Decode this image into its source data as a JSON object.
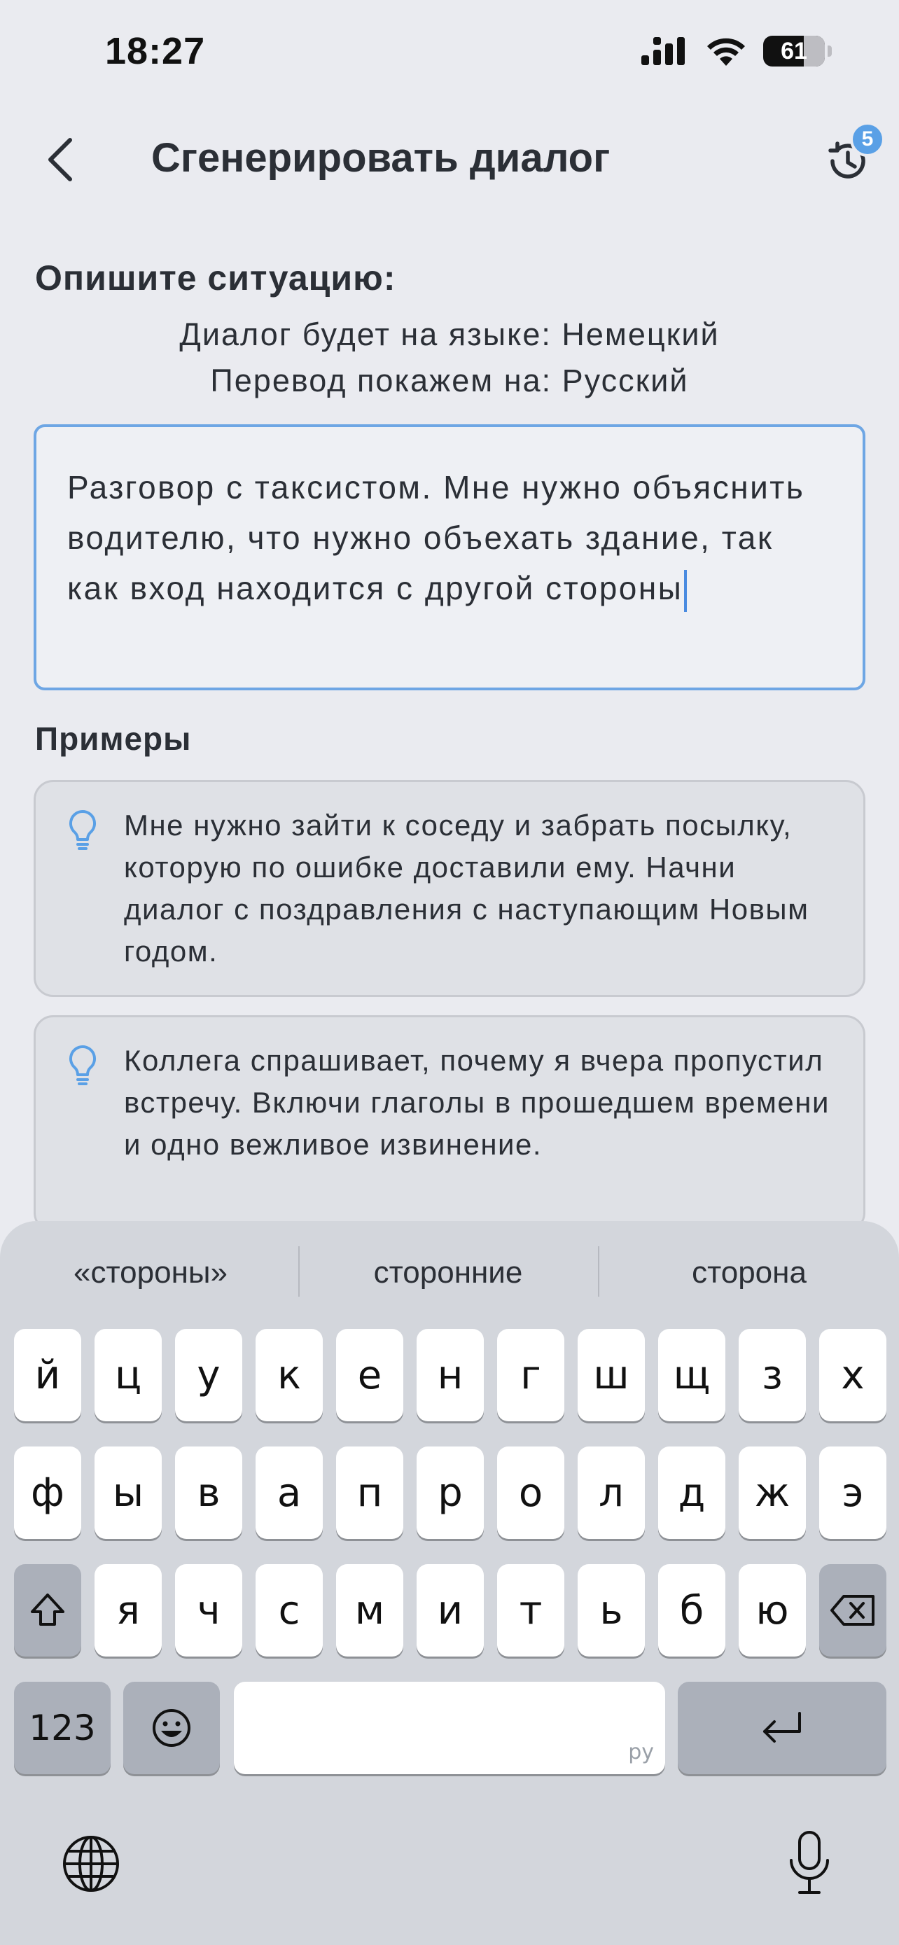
{
  "status": {
    "time": "18:27",
    "battery": "61"
  },
  "header": {
    "title": "Сгенерировать диалог",
    "history_badge": "5"
  },
  "describe": {
    "label": "Опишите ситуацию:",
    "language_line": "Диалог будет на языке: Немецкий",
    "translation_line": "Перевод покажем на: Русский",
    "input_value": "Разговор с таксистом. Мне нужно объяснить водителю, что нужно объехать здание, так как вход находится с другой стороны"
  },
  "examples": {
    "label": "Примеры",
    "items": [
      "Мне нужно зайти к соседу и забрать посылку, которую по ошибке доставили ему. Начни диалог с поздравления с наступающим Новым годом.",
      "Коллега спрашивает, почему я вчера пропустил встречу. Включи глаголы в прошедшем времени и одно вежливое извинение."
    ]
  },
  "keyboard": {
    "suggestions": [
      "«стороны»",
      "сторонние",
      "сторона"
    ],
    "row1": [
      "й",
      "ц",
      "у",
      "к",
      "е",
      "н",
      "г",
      "ш",
      "щ",
      "з",
      "х"
    ],
    "row2": [
      "ф",
      "ы",
      "в",
      "а",
      "п",
      "р",
      "о",
      "л",
      "д",
      "ж",
      "э"
    ],
    "row3": [
      "я",
      "ч",
      "с",
      "м",
      "и",
      "т",
      "ь",
      "б",
      "ю"
    ],
    "numbers_label": "123",
    "space_hint": "ру"
  },
  "colors": {
    "accent": "#5aa0e6",
    "background": "#eaebf0",
    "keyboard": "#d3d6dc"
  }
}
